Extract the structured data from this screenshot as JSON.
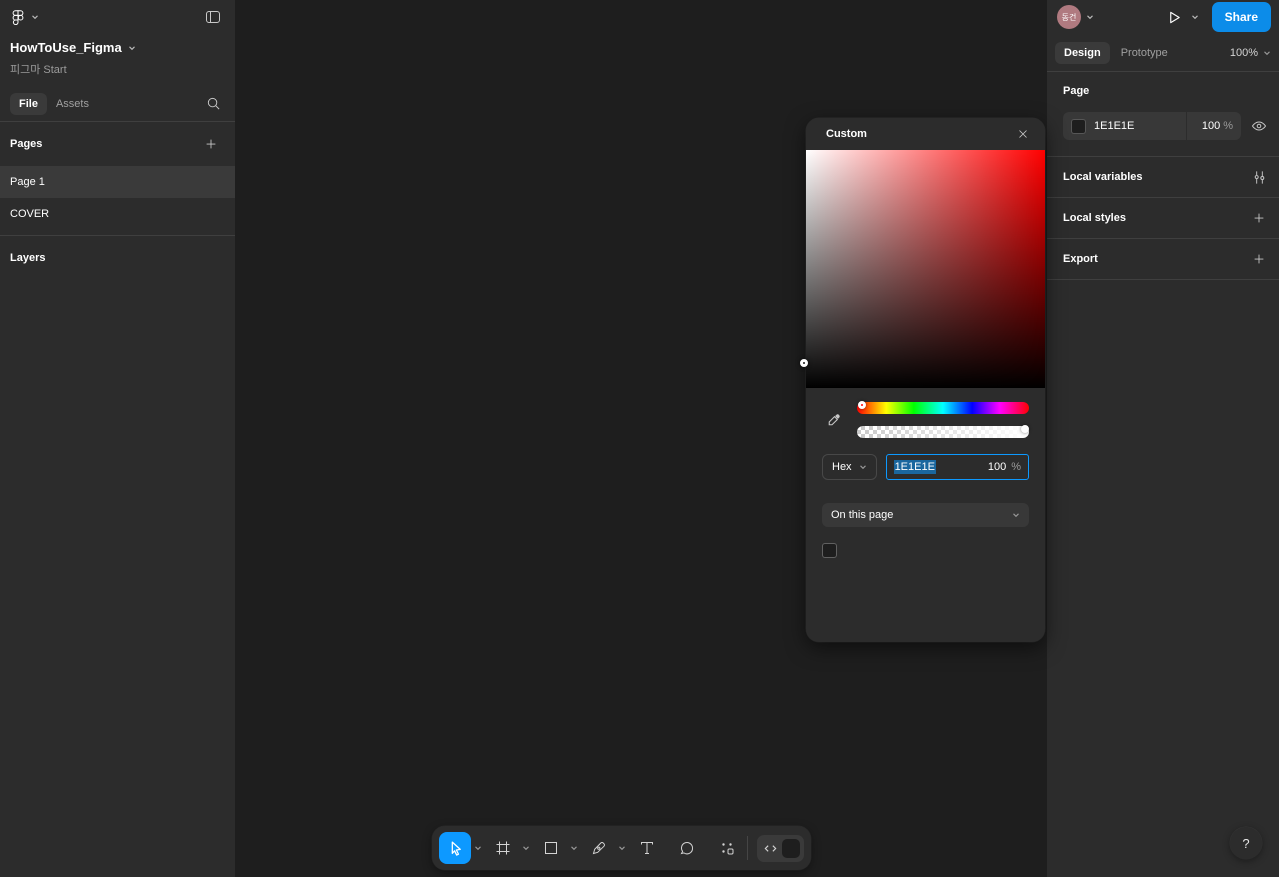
{
  "app": {
    "canvas_color": "#1E1E1E",
    "accent_color": "#0D99FF",
    "share_button_color": "#0C8CE9"
  },
  "left_sidebar": {
    "file_name": "HowToUse_Figma",
    "file_subtitle": "피그마 Start",
    "tabs": {
      "file": "File",
      "assets": "Assets"
    },
    "pages": {
      "header": "Pages",
      "items": [
        {
          "label": "Page 1",
          "selected": true
        },
        {
          "label": "COVER",
          "selected": false
        }
      ]
    },
    "layers_header": "Layers"
  },
  "color_picker": {
    "title": "Custom",
    "mode_label": "Hex",
    "hex_value": "1E1E1E",
    "opacity_value": "100",
    "opacity_unit": "%",
    "scope_label": "On this page"
  },
  "right_sidebar": {
    "avatar_initials": "동건",
    "share_label": "Share",
    "tabs": {
      "design": "Design",
      "prototype": "Prototype"
    },
    "zoom_level": "100%",
    "page_section": {
      "header": "Page",
      "hex_value": "1E1E1E",
      "opacity_value": "100",
      "opacity_unit": "%"
    },
    "local_variables_label": "Local variables",
    "local_styles_label": "Local styles",
    "export_label": "Export"
  },
  "toolbar": {
    "tools": [
      "move",
      "frame",
      "rectangle",
      "pen",
      "text",
      "comment",
      "actions",
      "dev-mode"
    ]
  },
  "help": {
    "label": "?"
  }
}
